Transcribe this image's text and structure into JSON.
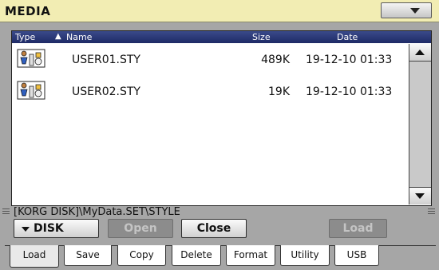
{
  "window": {
    "title": "MEDIA"
  },
  "menu": {
    "icon": "chevron-down-icon"
  },
  "list": {
    "headers": {
      "type": "Type",
      "name": "Name",
      "size": "Size",
      "date": "Date",
      "sort_icon": "sort-ascending-icon"
    },
    "rows": [
      {
        "icon": "style-file-icon",
        "name": "USER01.STY",
        "size": "489K",
        "date": "19-12-10 01:33"
      },
      {
        "icon": "style-file-icon",
        "name": "USER02.STY",
        "size": "19K",
        "date": "19-12-10 01:33"
      }
    ]
  },
  "path": "[KORG DISK]\\MyData.SET\\STYLE",
  "buttons": {
    "device": "DISK",
    "open": "Open",
    "close": "Close",
    "load": "Load"
  },
  "tabs": [
    {
      "label": "Load",
      "active": true
    },
    {
      "label": "Save"
    },
    {
      "label": "Copy"
    },
    {
      "label": "Delete"
    },
    {
      "label": "Format"
    },
    {
      "label": "Utility"
    },
    {
      "label": "USB"
    }
  ],
  "colors": {
    "title_bar": "#f2edb3",
    "header_bar": "#1e2a66",
    "panel_bg": "#a6a6a6"
  }
}
